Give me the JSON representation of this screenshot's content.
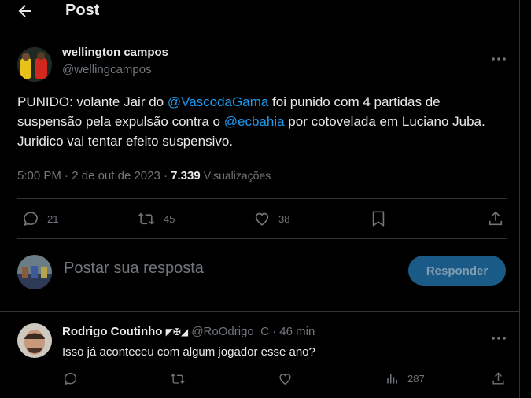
{
  "header": {
    "title": "Post"
  },
  "tweet": {
    "author_name": "wellington campos",
    "author_handle": "@wellingcampos",
    "text_parts": {
      "p1": "PUNIDO: volante Jair do ",
      "m1": "@VascodaGama",
      "p2": " foi punido com 4 partidas de suspensão pela expulsão contra o ",
      "m2": "@ecbahia",
      "p3": " por cotovelada em Luciano Juba. Juridico vai tentar efeito suspensivo."
    },
    "time": "5:00 PM",
    "date": "2 de out de 2023",
    "views": "7.339",
    "views_label": "Visualizações",
    "sep": "·",
    "replies": "21",
    "retweets": "45",
    "likes": "38"
  },
  "compose": {
    "placeholder": "Postar sua resposta",
    "button": "Responder"
  },
  "reply": {
    "name": "Rodrigo Coutinho",
    "badges": "◤✠◢",
    "handle": "@RoOdrigo_C",
    "sep": "·",
    "time": "46 min",
    "text": "Isso já aconteceu com algum jogador esse ano?",
    "views": "287"
  },
  "colors": {
    "accent": "#1d9bf0",
    "muted": "#71767b",
    "text": "#e7e9ea",
    "border": "#2f3336"
  }
}
